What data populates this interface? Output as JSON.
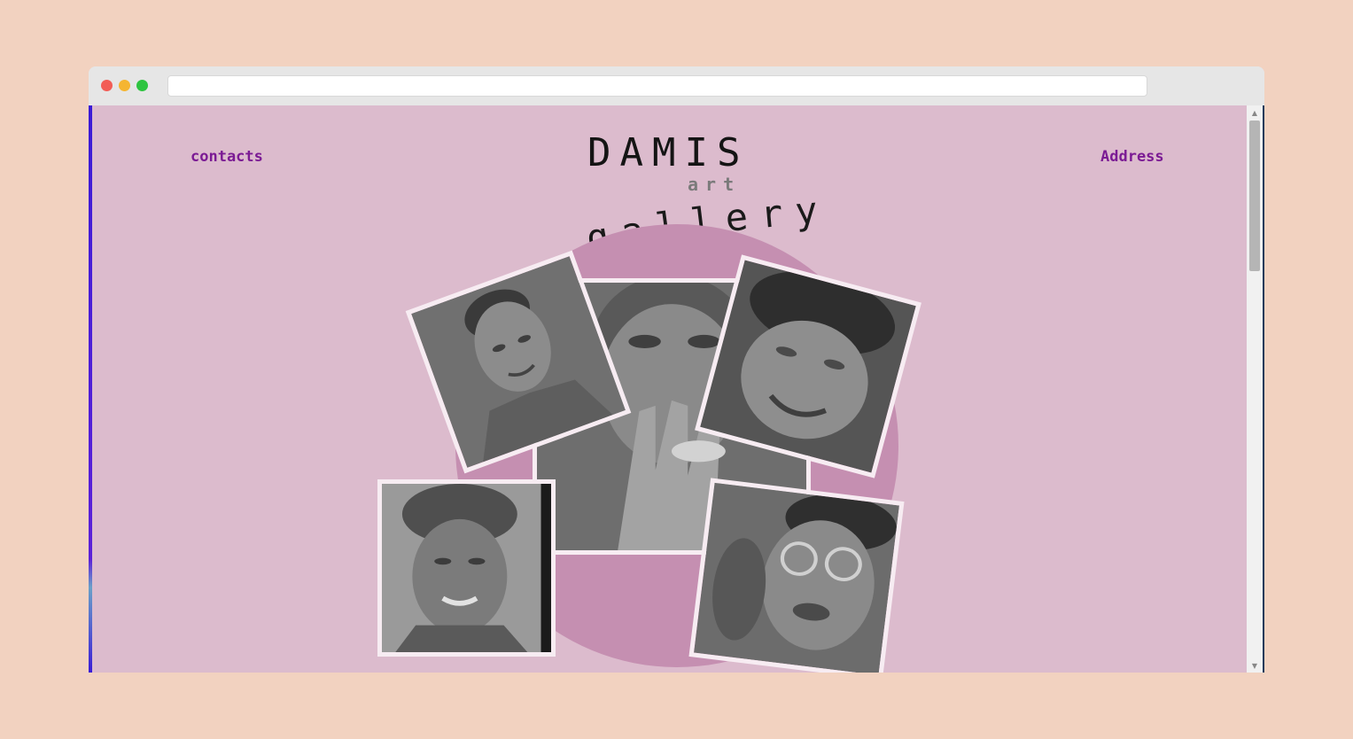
{
  "window": {
    "url": ""
  },
  "nav": {
    "left_link": "contacts",
    "right_link": "Address"
  },
  "brand": {
    "title": "DAMIS",
    "subtitle": "art",
    "tagline": "gallery"
  },
  "colors": {
    "page_background": "#f2d2c0",
    "site_background": "#dcbbcd",
    "circle": "#c58fb1",
    "link": "#7b1b94",
    "frame": "#f7ecf2"
  },
  "gallery": {
    "artworks": [
      {
        "subject": "hand over face portrait"
      },
      {
        "subject": "young man portrait"
      },
      {
        "subject": "smiling boy portrait"
      },
      {
        "subject": "elderly woman with headwrap"
      },
      {
        "subject": "woman with glasses"
      }
    ]
  }
}
